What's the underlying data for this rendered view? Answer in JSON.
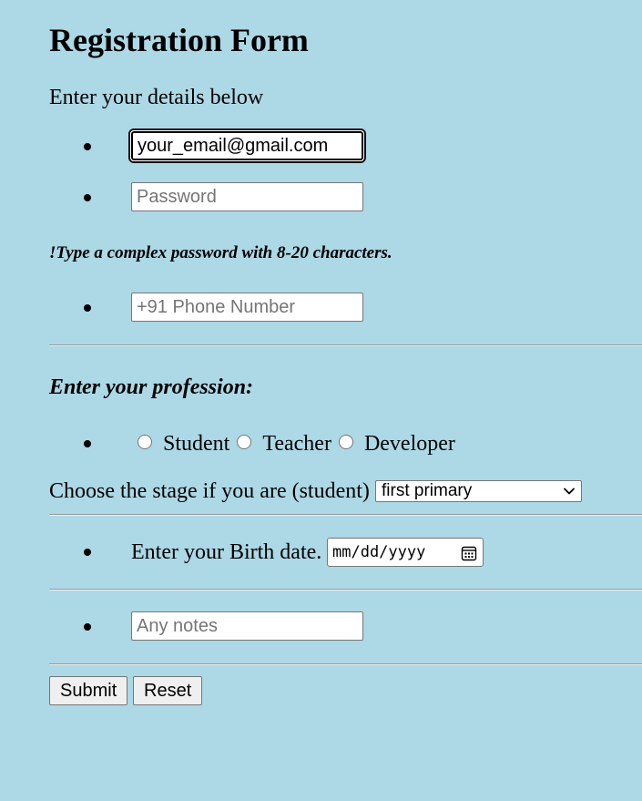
{
  "form": {
    "title": "Registration Form",
    "intro": "Enter your details below",
    "email": {
      "value": "your_email@gmail.com",
      "placeholder": ""
    },
    "password": {
      "value": "",
      "placeholder": "Password"
    },
    "password_hint": "!Type a complex password with 8-20 characters.",
    "phone": {
      "value": "",
      "placeholder": "+91 Phone Number"
    },
    "profession_label": "Enter your profession:",
    "professions": [
      "Student",
      "Teacher",
      "Developer"
    ],
    "stage_label": "Choose the stage if you are (student)",
    "stage_selected": "first primary",
    "birth_label": "Enter your Birth date.",
    "birth_date_placeholder": "mm/dd/yyyy",
    "notes": {
      "value": "",
      "placeholder": "Any notes"
    },
    "submit_label": "Submit",
    "reset_label": "Reset"
  },
  "colors": {
    "background": "#add8e6",
    "input_background": "#ffffff",
    "button_background": "#efefef"
  },
  "icons": {
    "select_arrow": "chevron-down-icon",
    "date_picker": "calendar-icon"
  }
}
